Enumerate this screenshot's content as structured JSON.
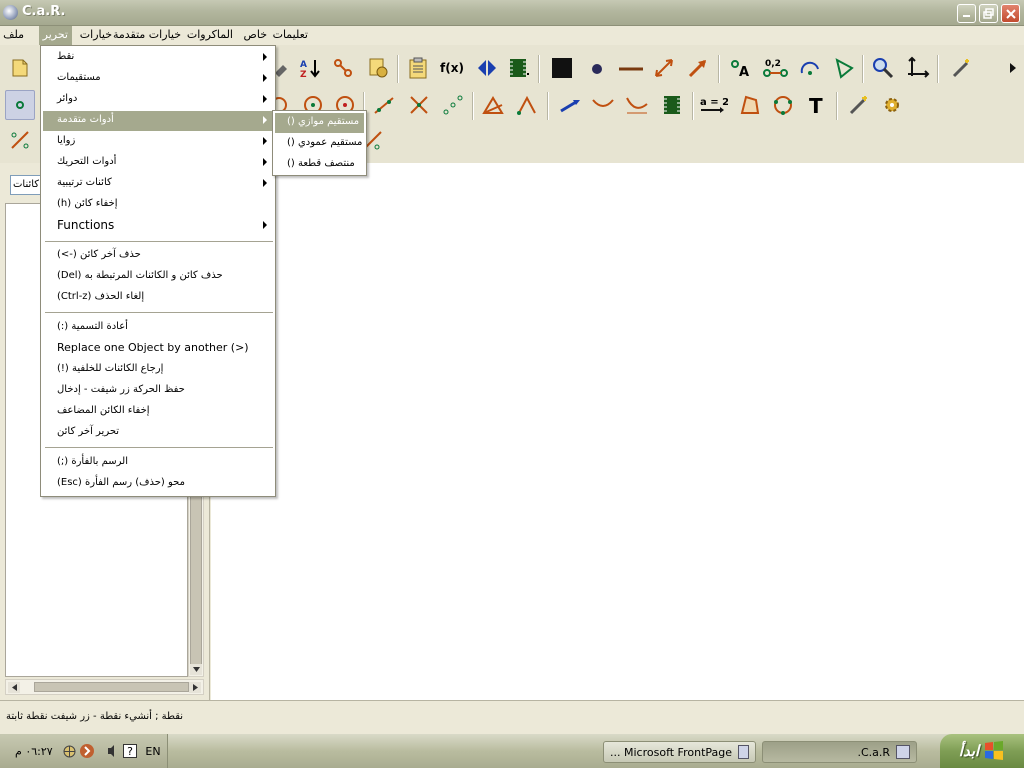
{
  "window": {
    "title": "C.a.R."
  },
  "menubar": {
    "items": [
      {
        "label": "ملف"
      },
      {
        "label": "تحرير"
      },
      {
        "label": "خيارات"
      },
      {
        "label": "خيارات متقدمة"
      },
      {
        "label": "الماكروات"
      },
      {
        "label": "خاص"
      },
      {
        "label": "تعليمات"
      }
    ]
  },
  "edit_menu": {
    "items": [
      {
        "label": "نقط"
      },
      {
        "label": "مستقيمات"
      },
      {
        "label": "دوائر"
      },
      {
        "label": "أدوات متقدمة"
      },
      {
        "label": "زوايا"
      },
      {
        "label": "أدوات التحريك"
      },
      {
        "label": "كائنات ترتيبية"
      },
      {
        "label": "(h) إخفاء كائن"
      },
      {
        "label": "Functions"
      },
      {
        "label": "(<-)     حذف آخر كائن"
      },
      {
        "label": "(Del) حذف كائن و الكائنات المرتبطة به"
      },
      {
        "label": "(Ctrl-z)       إلغاء الحذف"
      },
      {
        "label": "(:) أعادة التسمية"
      },
      {
        "label": "Replace one Object by another (>)"
      },
      {
        "label": "(!) إرجاع الكائنات للخلفية"
      },
      {
        "label": "حفظ الحركة زر شيفت - إدخال"
      },
      {
        "label": "إخفاء الكائن المضاعف"
      },
      {
        "label": "تحرير آخر كائن"
      },
      {
        "label": "(;) الرسم  بالفأرة"
      },
      {
        "label": "(Esc)    محو (حذف) رسم الفأرة"
      }
    ]
  },
  "advanced_submenu": {
    "items": [
      {
        "label": "() مستقيم موازي"
      },
      {
        "label": "() مستقيم عمودي"
      },
      {
        "label": "() منتصف قطعة"
      }
    ]
  },
  "left_panel": {
    "object_input": "كائنات"
  },
  "status": {
    "text": "نقطة ; أنشيء نقطة - زر شيفت نقطة ثابتة"
  },
  "taskbar": {
    "tasks": [
      {
        "label": "Microsoft FrontPage ..."
      },
      {
        "label": "C.a.R."
      }
    ],
    "start_label": "ابدأ",
    "clock": "٠٦:٢٧ م",
    "language": "EN"
  },
  "icons": [
    "pencil-icon",
    "sort-az-icon",
    "clipboard-icon",
    "fx-icon",
    "mirror-icon",
    "film-icon",
    "black-square-icon",
    "dot-icon",
    "segment-icon",
    "arrow-icon",
    "label-icon",
    "coordinates-icon",
    "arc-icon",
    "angle-icon",
    "zoom-icon",
    "axes-icon",
    "wand-icon",
    "point-icon",
    "text-icon",
    "gear-icon"
  ]
}
